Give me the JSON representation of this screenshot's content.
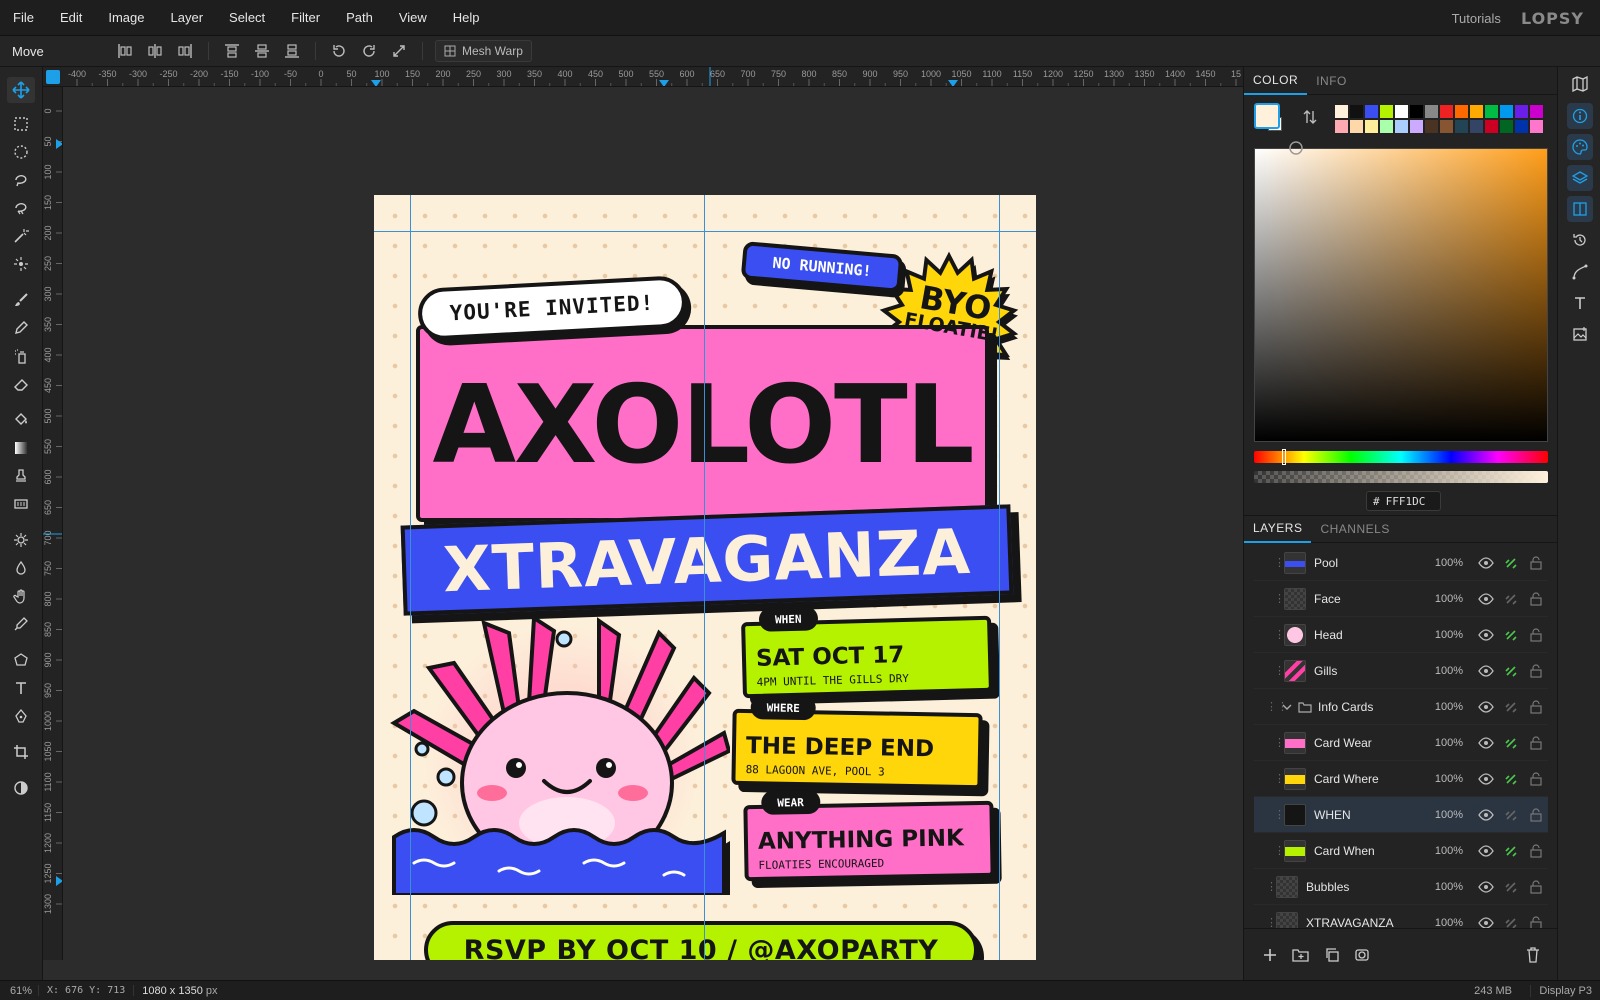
{
  "menubar": {
    "items": [
      "File",
      "Edit",
      "Image",
      "Layer",
      "Select",
      "Filter",
      "Path",
      "View",
      "Help"
    ],
    "tutorials": "Tutorials",
    "logo": "LOPSY"
  },
  "options": {
    "tool_name": "Move",
    "mesh_warp": "Mesh Warp"
  },
  "toolbox": [
    "move",
    "rect-select",
    "ellipse-select",
    "lasso",
    "magnetic-lasso",
    "magic-wand",
    "quick-select",
    "brush",
    "pencil",
    "spray",
    "eraser",
    "fill",
    "gradient",
    "stamp",
    "text-pattern",
    "dodge",
    "burn",
    "hand",
    "eyedropper",
    "polygon",
    "text",
    "pen",
    "crop",
    "contrast"
  ],
  "ruler": {
    "h_labels": [
      "-400",
      "-350",
      "-300",
      "-250",
      "-200",
      "-150",
      "-100",
      "-50",
      "0",
      "50",
      "100",
      "150",
      "200",
      "250",
      "300",
      "350",
      "400",
      "450",
      "500",
      "550",
      "600",
      "650",
      "700",
      "750",
      "800",
      "850",
      "900",
      "950",
      "1000",
      "1050",
      "1100",
      "1150",
      "1200",
      "1250",
      "1300",
      "1350",
      "1400",
      "1450",
      "15"
    ],
    "v_labels": [
      "0",
      "50",
      "100",
      "150",
      "200",
      "250",
      "300",
      "350",
      "400",
      "450",
      "500",
      "550",
      "600",
      "650",
      "700",
      "750",
      "800",
      "850",
      "900",
      "950",
      "1000",
      "1050",
      "1100",
      "1150",
      "1200",
      "1250",
      "1300"
    ]
  },
  "poster": {
    "invited": "YOU'RE INVITED!",
    "title": "AXOLOTL",
    "subtitle": "XTRAVAGANZA",
    "no_running": "NO RUNNING!",
    "byo_line1": "BYO",
    "byo_line2": "FLOATIE!",
    "cards": {
      "when": {
        "tag": "WHEN",
        "main": "SAT OCT 17",
        "sub": "4PM UNTIL THE GILLS DRY",
        "color": "#b4f200"
      },
      "where": {
        "tag": "WHERE",
        "main": "THE DEEP END",
        "sub": "88 LAGOON AVE, POOL 3",
        "color": "#ffd60a"
      },
      "wear": {
        "tag": "WEAR",
        "main": "ANYTHING PINK",
        "sub": "FLOATIES ENCOURAGED",
        "color": "#ff6ec7"
      }
    },
    "rsvp": "RSVP BY OCT 10  /  @AXOPARTY"
  },
  "color_panel": {
    "tabs": [
      "COLOR",
      "INFO"
    ],
    "hex_prefix": "#",
    "hex": "FFF1DC",
    "foreground": "#fff1dc",
    "swatches": [
      "#fff1dc",
      "#111111",
      "#3a4ef2",
      "#b4f200",
      "#ffffff",
      "#000000",
      "#888888",
      "#ee2222",
      "#ff6a00",
      "#ffaa00",
      "#00bb44",
      "#0099ee",
      "#6a1ee8",
      "#cc00cc",
      "#ffaab0",
      "#ffd8aa",
      "#ffee99",
      "#aaffaa",
      "#aaccff",
      "#ccaaff",
      "#4a3322",
      "#885533",
      "#224455",
      "#334466",
      "#cc0022",
      "#006622",
      "#0033aa",
      "#ff77cc"
    ]
  },
  "layers_panel": {
    "tabs": [
      "LAYERS",
      "CHANNELS"
    ],
    "rows": [
      {
        "name": "Pool",
        "opacity": "100%"
      },
      {
        "name": "Face",
        "opacity": "100%"
      },
      {
        "name": "Head",
        "opacity": "100%"
      },
      {
        "name": "Gills",
        "opacity": "100%"
      },
      {
        "name": "Info Cards",
        "opacity": "100%"
      },
      {
        "name": "Card Wear",
        "opacity": "100%"
      },
      {
        "name": "Card Where",
        "opacity": "100%"
      },
      {
        "name": "WHEN",
        "opacity": "100%"
      },
      {
        "name": "Card When",
        "opacity": "100%"
      },
      {
        "name": "Bubbles",
        "opacity": "100%"
      },
      {
        "name": "XTRAVAGANZA",
        "opacity": "100%"
      }
    ]
  },
  "status": {
    "zoom": "61%",
    "coords": "X: 676  Y: 713",
    "dims_value": "1080 x 1350",
    "dims_unit": "px",
    "memory": "243 MB",
    "display": "Display P3"
  }
}
